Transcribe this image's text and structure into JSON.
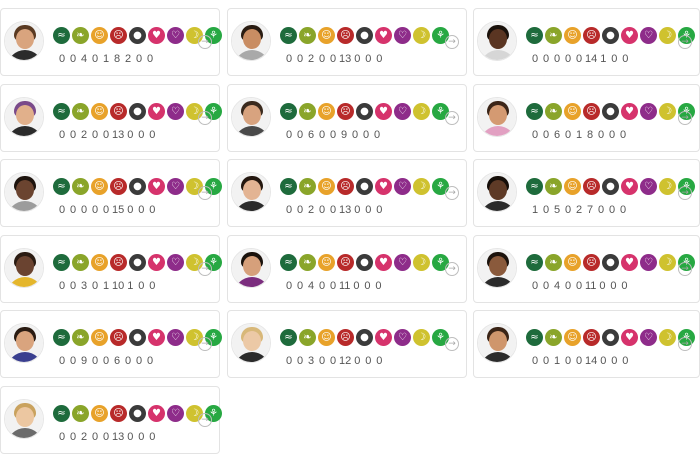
{
  "icon_set": [
    {
      "name": "wave-icon",
      "glyph": "≈",
      "color": "#1e6b3c"
    },
    {
      "name": "leaf-icon",
      "glyph": "❧",
      "color": "#8aa52a"
    },
    {
      "name": "smile-icon",
      "glyph": "☺",
      "color": "#e8a22a"
    },
    {
      "name": "frown-icon",
      "glyph": "☹",
      "color": "#b82a2a"
    },
    {
      "name": "bomb-icon",
      "glyph": "●",
      "color": "#3b3b3b"
    },
    {
      "name": "heart-icon",
      "glyph": "♥",
      "color": "#d6336c"
    },
    {
      "name": "broken-heart-icon",
      "glyph": "♡",
      "color": "#8e2c8a"
    },
    {
      "name": "banana-icon",
      "glyph": "☽",
      "color": "#cfc22f"
    },
    {
      "name": "plant-icon",
      "glyph": "⚘",
      "color": "#27a842"
    }
  ],
  "arrow_glyph": "→",
  "participants": [
    {
      "counts": [
        "0",
        "0",
        "4",
        "0",
        "1",
        "8",
        "2",
        "0",
        "0"
      ],
      "skin": "#d9a47e",
      "hair": "#5a3a22",
      "shirt": "#2b2b2b"
    },
    {
      "counts": [
        "0",
        "0",
        "2",
        "0",
        "0",
        "13",
        "0",
        "0",
        "0"
      ],
      "skin": "#c98d63",
      "hair": "#2a1c12",
      "shirt": "#a9a9a9"
    },
    {
      "counts": [
        "0",
        "0",
        "0",
        "0",
        "0",
        "14",
        "1",
        "0",
        "0"
      ],
      "skin": "#5a3522",
      "hair": "#1a110b",
      "shirt": "#d6d6d6"
    },
    {
      "counts": [
        "0",
        "0",
        "2",
        "0",
        "0",
        "13",
        "0",
        "0",
        "0"
      ],
      "skin": "#e1b08b",
      "hair": "#7a4a8a",
      "shirt": "#2b2b2b"
    },
    {
      "counts": [
        "0",
        "0",
        "6",
        "0",
        "0",
        "9",
        "0",
        "0",
        "0"
      ],
      "skin": "#d8a37f",
      "hair": "#3a2a1e",
      "shirt": "#4a4a4a"
    },
    {
      "counts": [
        "0",
        "0",
        "6",
        "0",
        "1",
        "8",
        "0",
        "0",
        "0"
      ],
      "skin": "#d49a72",
      "hair": "#3b2518",
      "shirt": "#e2a0c2"
    },
    {
      "counts": [
        "0",
        "0",
        "0",
        "0",
        "0",
        "15",
        "0",
        "0",
        "0"
      ],
      "skin": "#6b4430",
      "hair": "#1e140e",
      "shirt": "#9c9c9c"
    },
    {
      "counts": [
        "0",
        "0",
        "2",
        "0",
        "0",
        "13",
        "0",
        "0",
        "0"
      ],
      "skin": "#e3b493",
      "hair": "#24170f",
      "shirt": "#2b2b2b"
    },
    {
      "counts": [
        "1",
        "0",
        "5",
        "0",
        "2",
        "7",
        "0",
        "0",
        "0"
      ],
      "skin": "#5e3a26",
      "hair": "#150e09",
      "shirt": "#2b2b2b"
    },
    {
      "counts": [
        "0",
        "0",
        "3",
        "0",
        "1",
        "10",
        "1",
        "0",
        "0"
      ],
      "skin": "#6a4330",
      "hair": "#2a1b12",
      "shirt": "#e4b62c"
    },
    {
      "counts": [
        "0",
        "0",
        "4",
        "0",
        "0",
        "11",
        "0",
        "0",
        "0"
      ],
      "skin": "#d6a07b",
      "hair": "#1a120c",
      "shirt": "#7b2d7e"
    },
    {
      "counts": [
        "0",
        "0",
        "4",
        "0",
        "0",
        "11",
        "0",
        "0",
        "0"
      ],
      "skin": "#8a5a3c",
      "hair": "#1c130d",
      "shirt": "#2b2b2b"
    },
    {
      "counts": [
        "0",
        "0",
        "9",
        "0",
        "0",
        "6",
        "0",
        "0",
        "0"
      ],
      "skin": "#d9a47e",
      "hair": "#2a1b12",
      "shirt": "#3a3f8f"
    },
    {
      "counts": [
        "0",
        "0",
        "3",
        "0",
        "0",
        "12",
        "0",
        "0",
        "0"
      ],
      "skin": "#ecc9a6",
      "hair": "#d8b879",
      "shirt": "#2b2b2b"
    },
    {
      "counts": [
        "0",
        "0",
        "1",
        "0",
        "0",
        "14",
        "0",
        "0",
        "0"
      ],
      "skin": "#cf966c",
      "hair": "#3a2416",
      "shirt": "#2b2b2b"
    },
    {
      "counts": [
        "0",
        "0",
        "2",
        "0",
        "0",
        "13",
        "0",
        "0",
        "0"
      ],
      "skin": "#ecc7a1",
      "hair": "#c9a25e",
      "shirt": "#6b6b6b"
    }
  ]
}
